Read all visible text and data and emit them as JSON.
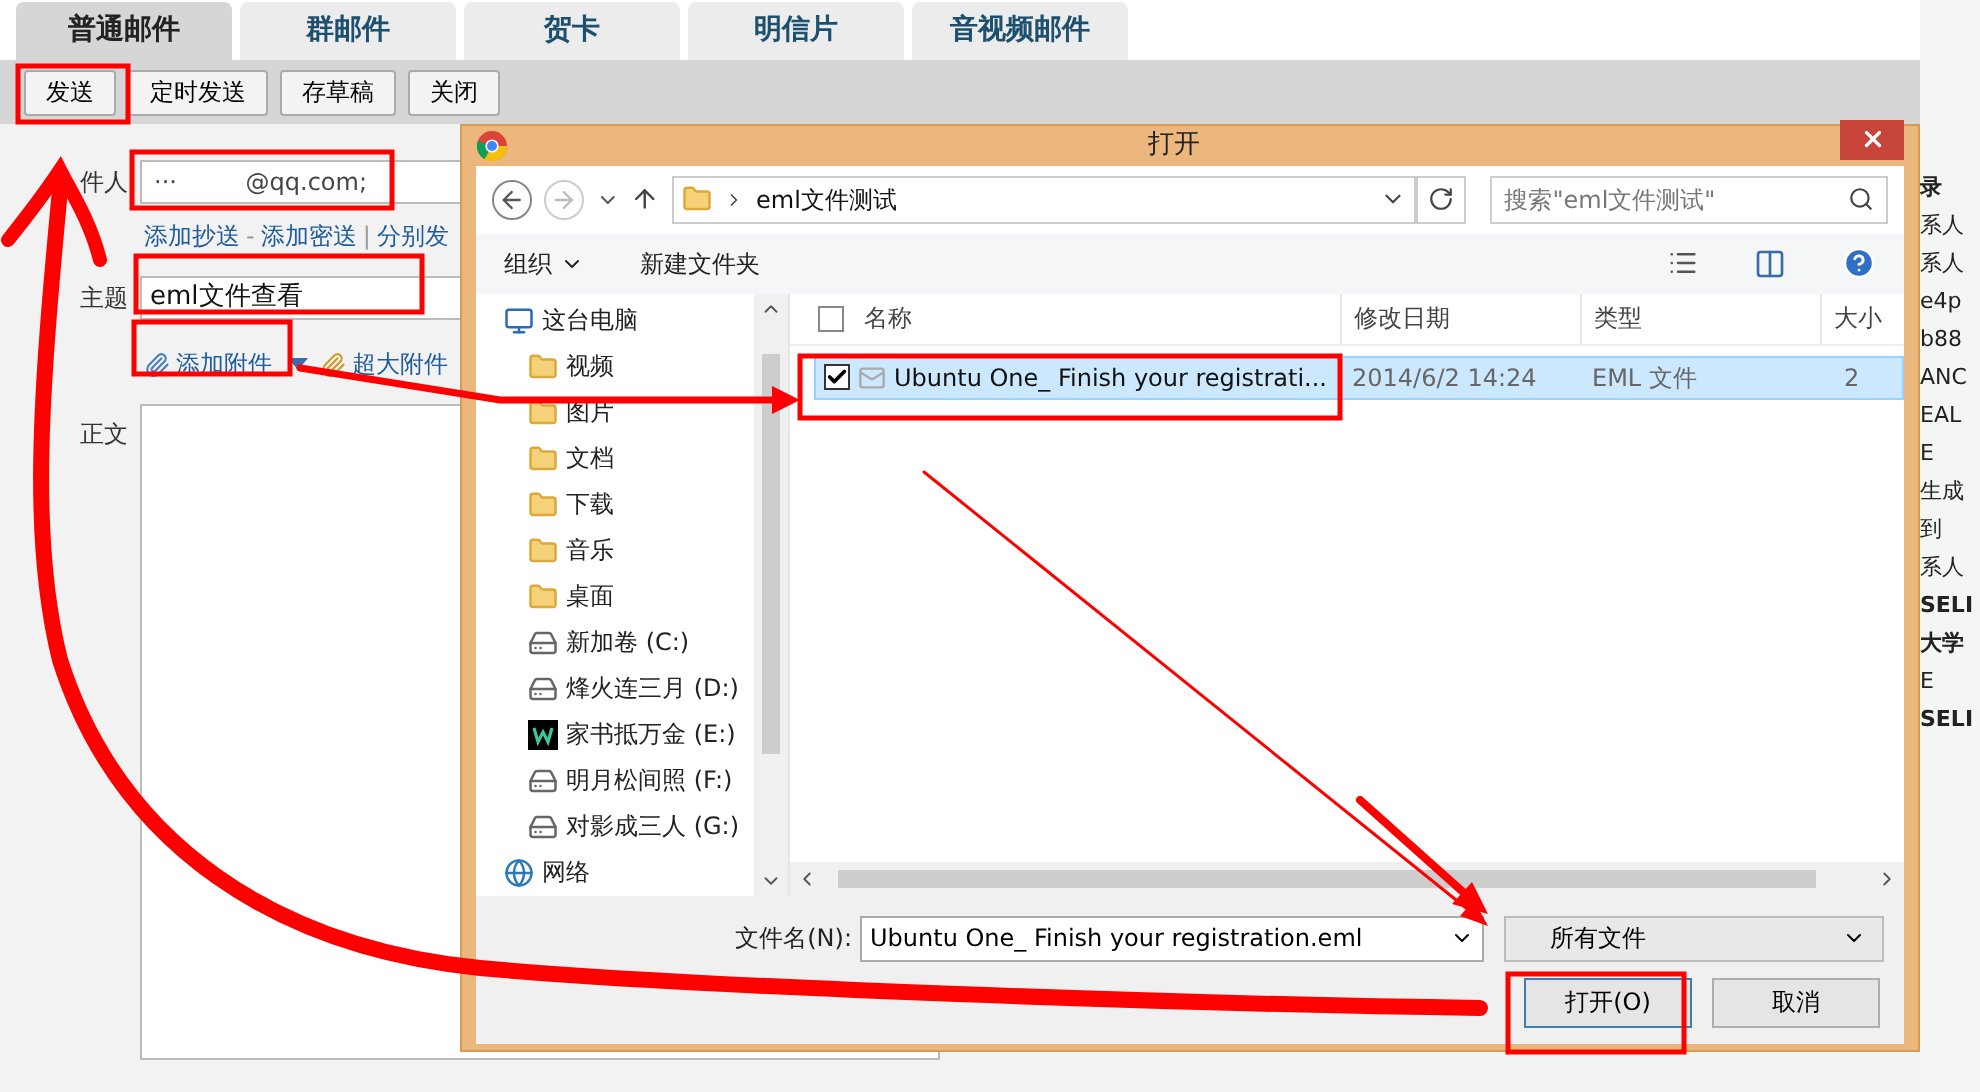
{
  "tabs": [
    {
      "label": "普通邮件",
      "selected": true
    },
    {
      "label": "群邮件",
      "selected": false
    },
    {
      "label": "贺卡",
      "selected": false
    },
    {
      "label": "明信片",
      "selected": false
    },
    {
      "label": "音视频邮件",
      "selected": false
    }
  ],
  "toolbar": {
    "buttons": [
      "发送",
      "定时发送",
      "存草稿",
      "关闭"
    ]
  },
  "compose": {
    "to_label": "件人",
    "to_value": "···         @qq.com;",
    "cc_links": [
      {
        "kind": "link",
        "label": "添加抄送"
      },
      {
        "kind": "separator",
        "label": "-"
      },
      {
        "kind": "link",
        "label": "添加密送"
      },
      {
        "kind": "separator",
        "label": "|"
      },
      {
        "kind": "link",
        "label": "分别发"
      }
    ],
    "subject_label": "主题",
    "subject_value": "eml文件查看",
    "attach_link": "添加附件",
    "big_attach_link": "超大附件",
    "body_label": "正文"
  },
  "side_panel": {
    "items": [
      {
        "label": "录",
        "bold": true
      },
      {
        "label": "系人",
        "bold": false
      },
      {
        "label": "系人",
        "bold": false
      },
      {
        "label": "e4p",
        "bold": false
      },
      {
        "label": "b88",
        "bold": false
      },
      {
        "label": "ANC",
        "bold": false
      },
      {
        "label": "EAL",
        "bold": false
      },
      {
        "label": "E",
        "bold": false
      },
      {
        "label": "生成",
        "bold": false
      },
      {
        "label": "到",
        "bold": false
      },
      {
        "label": "系人",
        "bold": false
      },
      {
        "label": "SELI",
        "bold": true
      },
      {
        "label": "大学",
        "bold": true
      },
      {
        "label": "E",
        "bold": false
      },
      {
        "label": "SELI",
        "bold": true
      }
    ]
  },
  "dialog": {
    "title": "打开",
    "path": "eml文件测试",
    "search": {
      "placeholder": "搜索\"eml文件测试\""
    },
    "toolbar": [
      "组织",
      "新建文件夹"
    ],
    "nav": [
      {
        "label": "这台电脑",
        "kind": "computer",
        "children": [
          {
            "label": "视频",
            "kind": "folder"
          },
          {
            "label": "图片",
            "kind": "folder"
          },
          {
            "label": "文档",
            "kind": "folder"
          },
          {
            "label": "下载",
            "kind": "folder"
          },
          {
            "label": "音乐",
            "kind": "folder"
          },
          {
            "label": "桌面",
            "kind": "folder"
          },
          {
            "label": "新加卷 (C:)",
            "kind": "drive"
          },
          {
            "label": "烽火连三月 (D:)",
            "kind": "drive"
          },
          {
            "label": "家书抵万金 (E:)",
            "kind": "app"
          },
          {
            "label": "明月松间照 (F:)",
            "kind": "drive"
          },
          {
            "label": "对影成三人 (G:)",
            "kind": "drive"
          }
        ]
      },
      {
        "label": "网络",
        "kind": "network"
      }
    ],
    "select_all": {
      "checked": false
    },
    "columns": [
      "名称",
      "修改日期",
      "类型",
      "大小"
    ],
    "rows": [
      {
        "name": "Ubuntu One_ Finish your registrati...",
        "date": "2014/6/2 14:24",
        "type": "EML 文件",
        "size": "2",
        "checked": true,
        "selected": true
      }
    ],
    "filename_label": "文件名(N):",
    "filename_value": "Ubuntu One_ Finish your registration.eml",
    "filetype": "所有文件",
    "buttons": [
      "打开(O)",
      "取消"
    ]
  }
}
